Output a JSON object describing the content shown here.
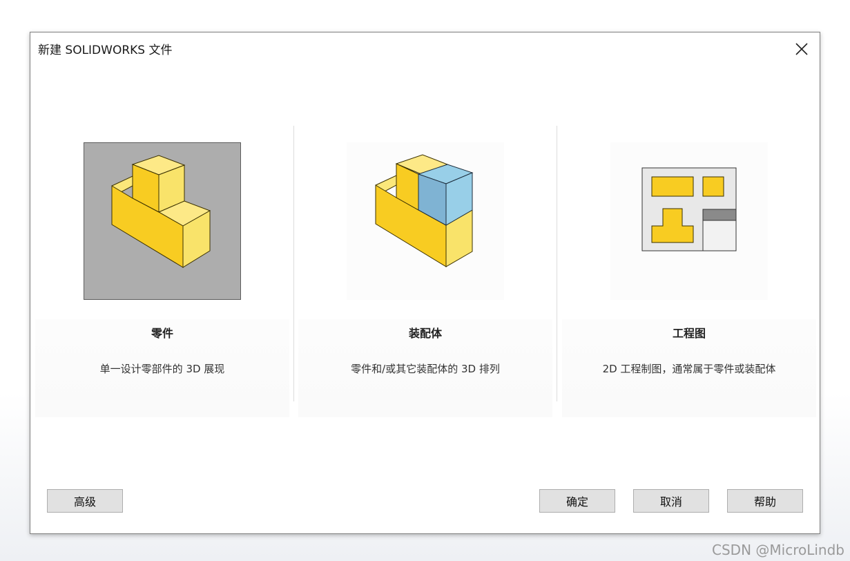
{
  "dialog": {
    "title": "新建 SOLIDWORKS 文件",
    "close_icon": "close-icon"
  },
  "cards": [
    {
      "name": "零件",
      "description": "单一设计零部件的 3D 展现",
      "icon": "part-icon",
      "selected": true
    },
    {
      "name": "装配体",
      "description": "零件和/或其它装配体的 3D 排列",
      "icon": "assembly-icon",
      "selected": false
    },
    {
      "name": "工程图",
      "description": "2D 工程制图，通常属于零件或装配体",
      "icon": "drawing-icon",
      "selected": false
    }
  ],
  "buttons": {
    "advanced": "高级",
    "ok": "确定",
    "cancel": "取消",
    "help": "帮助"
  },
  "watermark": "CSDN @MicroLindb",
  "colors": {
    "selected_bg": "#adadad",
    "yellow": "#f8cc22",
    "blue": "#7fb3d3"
  }
}
